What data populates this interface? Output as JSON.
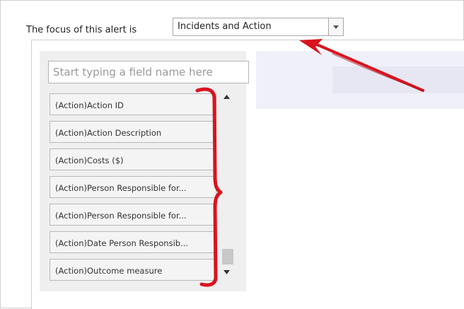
{
  "focus": {
    "label": "The focus of this alert is",
    "selected": "Incidents and Action"
  },
  "search": {
    "placeholder": "Start typing a field name here"
  },
  "fields": [
    "(Action)Action ID",
    "(Action)Action Description",
    "(Action)Costs ($)",
    "(Action)Person Responsible for...",
    "(Action)Person Responsible for...",
    "(Action)Date Person Responsib...",
    "(Action)Outcome measure"
  ],
  "icons": {
    "dropdown": "chevron-down-icon",
    "scroll_up": "scroll-up-icon",
    "scroll_down": "scroll-down-icon"
  },
  "colors": {
    "annotation": "#d8141e",
    "preview_band": "#f0f0fa",
    "field_panel": "#efefef"
  }
}
